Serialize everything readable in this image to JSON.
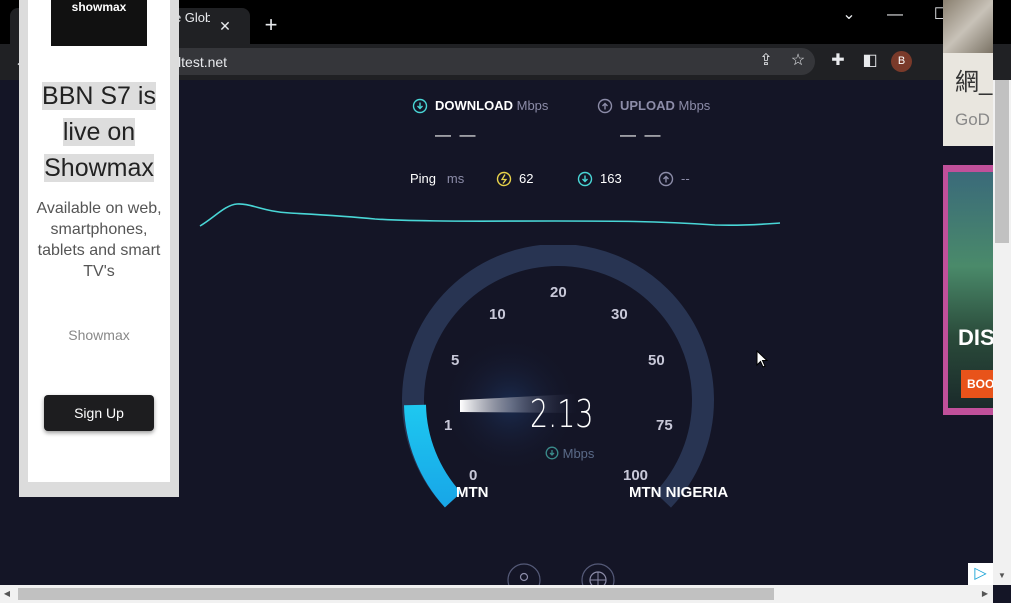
{
  "browser": {
    "tab_title": "Speedtest by Ookla - The Global",
    "url": "speedtest.net",
    "profile_initial": "B"
  },
  "left_ad": {
    "logo": "showmax",
    "headline": [
      "BBN S7 is",
      "live on",
      "Showmax"
    ],
    "subtext": "Available on web, smartphones, tablets and smart TV's",
    "brand": "Showmax",
    "button": "Sign Up"
  },
  "speedtest": {
    "download_label": "DOWNLOAD",
    "upload_label": "UPLOAD",
    "unit_mbps": "Mbps",
    "download_value": "— —",
    "upload_value": "— —",
    "ping_label": "Ping",
    "ping_unit": "ms",
    "ping_value": "62",
    "download_latency": "163",
    "upload_latency": "--",
    "gauge_labels": [
      "0",
      "1",
      "5",
      "10",
      "20",
      "30",
      "50",
      "75",
      "100"
    ],
    "current_speed": "2.13",
    "current_unit": "Mbps",
    "isp": "MTN",
    "server": "MTN NIGERIA",
    "accent_color": "#1ec8f0",
    "graph_color": "#49d6d6"
  },
  "right_ad1": {
    "text": "網_",
    "sub": "GoD"
  },
  "right_ad2": {
    "text": "DISC",
    "button": "BOO"
  }
}
